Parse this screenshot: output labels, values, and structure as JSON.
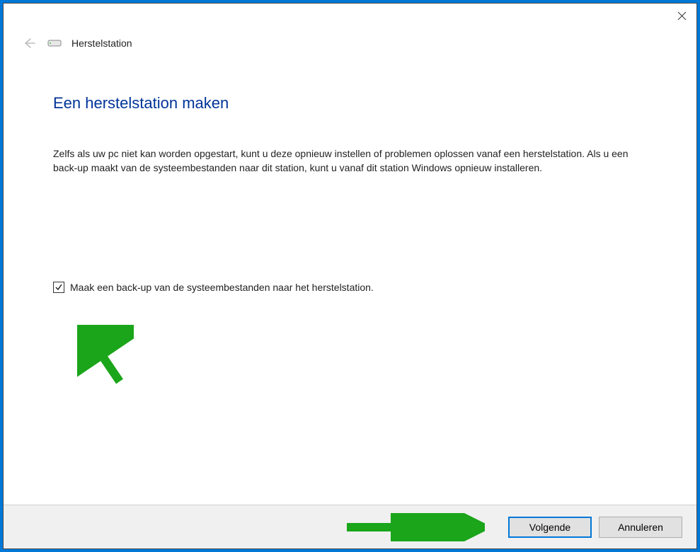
{
  "window": {
    "title": "Herstelstation"
  },
  "page": {
    "heading": "Een herstelstation maken",
    "description": "Zelfs als uw pc niet kan worden opgestart, kunt u deze opnieuw instellen of problemen oplossen vanaf een herstelstation. Als u een back-up maakt van de systeembestanden naar dit station, kunt u vanaf dit station Windows opnieuw installeren."
  },
  "checkbox": {
    "label": "Maak een back-up van de systeembestanden naar het herstelstation.",
    "checked": true
  },
  "buttons": {
    "next": "Volgende",
    "cancel": "Annuleren"
  }
}
